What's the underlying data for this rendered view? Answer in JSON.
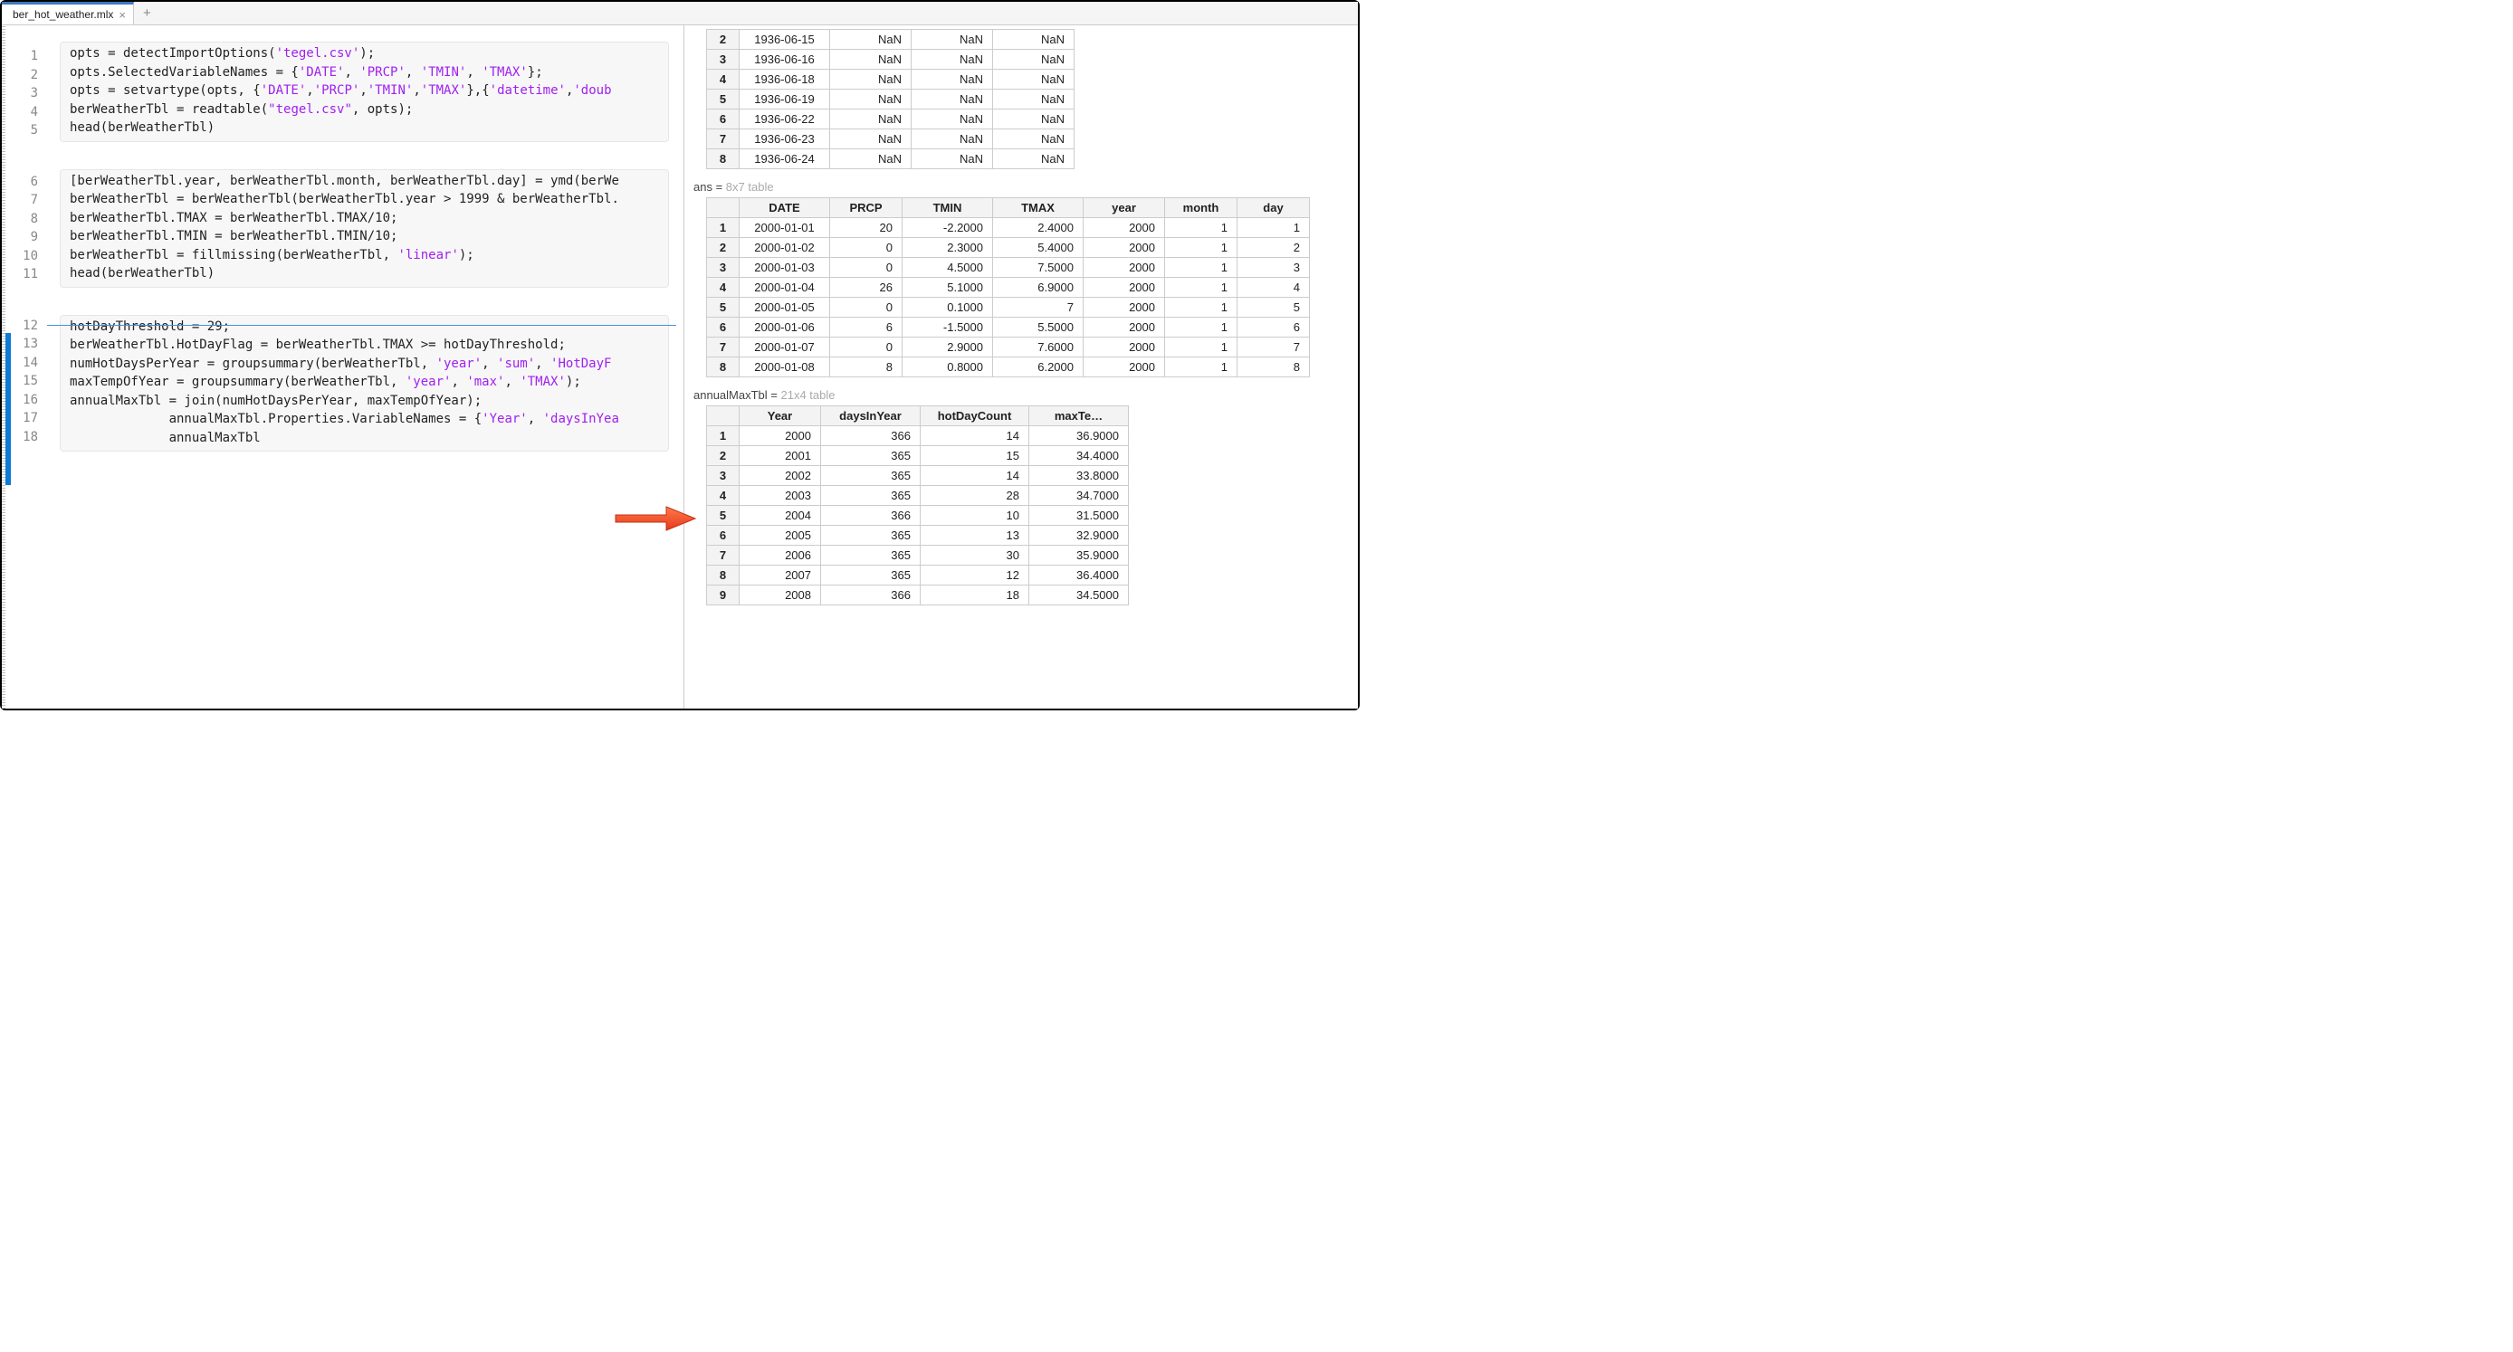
{
  "tab": {
    "title": "ber_hot_weather.mlx"
  },
  "lineNumbers": [
    1,
    2,
    3,
    4,
    5,
    6,
    7,
    8,
    9,
    10,
    11,
    12,
    13,
    14,
    15,
    16,
    17,
    18
  ],
  "code": {
    "cell1": [
      [
        [
          "plain",
          "opts = detectImportOptions("
        ],
        [
          "str",
          "'tegel.csv'"
        ],
        [
          "plain",
          ");"
        ]
      ],
      [
        [
          "plain",
          "opts.SelectedVariableNames = {"
        ],
        [
          "str",
          "'DATE'"
        ],
        [
          "plain",
          ", "
        ],
        [
          "str",
          "'PRCP'"
        ],
        [
          "plain",
          ", "
        ],
        [
          "str",
          "'TMIN'"
        ],
        [
          "plain",
          ", "
        ],
        [
          "str",
          "'TMAX'"
        ],
        [
          "plain",
          "};"
        ]
      ],
      [
        [
          "plain",
          "opts = setvartype(opts, {"
        ],
        [
          "str",
          "'DATE'"
        ],
        [
          "plain",
          ","
        ],
        [
          "str",
          "'PRCP'"
        ],
        [
          "plain",
          ","
        ],
        [
          "str",
          "'TMIN'"
        ],
        [
          "plain",
          ","
        ],
        [
          "str",
          "'TMAX'"
        ],
        [
          "plain",
          "},{"
        ],
        [
          "str",
          "'datetime'"
        ],
        [
          "plain",
          ","
        ],
        [
          "str",
          "'doub"
        ]
      ],
      [
        [
          "plain",
          "berWeatherTbl = readtable("
        ],
        [
          "str",
          "\"tegel.csv\""
        ],
        [
          "plain",
          ", opts);"
        ]
      ],
      [
        [
          "plain",
          "head(berWeatherTbl)"
        ]
      ]
    ],
    "cell2": [
      [
        [
          "plain",
          "[berWeatherTbl.year, berWeatherTbl.month, berWeatherTbl.day] = ymd(berWe"
        ]
      ],
      [
        [
          "plain",
          "berWeatherTbl = berWeatherTbl(berWeatherTbl.year > 1999 & berWeatherTbl."
        ]
      ],
      [
        [
          "plain",
          "berWeatherTbl.TMAX = berWeatherTbl.TMAX/10;"
        ]
      ],
      [
        [
          "plain",
          "berWeatherTbl.TMIN = berWeatherTbl.TMIN/10;"
        ]
      ],
      [
        [
          "plain",
          "berWeatherTbl = fillmissing(berWeatherTbl, "
        ],
        [
          "str",
          "'linear'"
        ],
        [
          "plain",
          ");"
        ]
      ],
      [
        [
          "plain",
          "head(berWeatherTbl)"
        ]
      ]
    ],
    "cell3": [
      [
        [
          "plain",
          "hotDayThreshold = 29;"
        ]
      ],
      [
        [
          "plain",
          "berWeatherTbl.HotDayFlag = berWeatherTbl.TMAX >= hotDayThreshold;"
        ]
      ],
      [
        [
          "plain",
          "numHotDaysPerYear = groupsummary(berWeatherTbl, "
        ],
        [
          "str",
          "'year'"
        ],
        [
          "plain",
          ", "
        ],
        [
          "str",
          "'sum'"
        ],
        [
          "plain",
          ", "
        ],
        [
          "str",
          "'HotDayF"
        ]
      ],
      [
        [
          "plain",
          "maxTempOfYear = groupsummary(berWeatherTbl, "
        ],
        [
          "str",
          "'year'"
        ],
        [
          "plain",
          ", "
        ],
        [
          "str",
          "'max'"
        ],
        [
          "plain",
          ", "
        ],
        [
          "str",
          "'TMAX'"
        ],
        [
          "plain",
          ");"
        ]
      ],
      [
        [
          "plain",
          "annualMaxTbl = join(numHotDaysPerYear, maxTempOfYear);"
        ]
      ],
      [
        [
          "plain",
          "             annualMaxTbl.Properties.VariableNames = {"
        ],
        [
          "str",
          "'Year'"
        ],
        [
          "plain",
          ", "
        ],
        [
          "str",
          "'daysInYea"
        ]
      ],
      [
        [
          "plain",
          "             annualMaxTbl"
        ]
      ]
    ]
  },
  "output": {
    "table1": {
      "rows": [
        [
          2,
          "1936-06-15",
          "NaN",
          "NaN",
          "NaN"
        ],
        [
          3,
          "1936-06-16",
          "NaN",
          "NaN",
          "NaN"
        ],
        [
          4,
          "1936-06-18",
          "NaN",
          "NaN",
          "NaN"
        ],
        [
          5,
          "1936-06-19",
          "NaN",
          "NaN",
          "NaN"
        ],
        [
          6,
          "1936-06-22",
          "NaN",
          "NaN",
          "NaN"
        ],
        [
          7,
          "1936-06-23",
          "NaN",
          "NaN",
          "NaN"
        ],
        [
          8,
          "1936-06-24",
          "NaN",
          "NaN",
          "NaN"
        ]
      ]
    },
    "table2": {
      "var": "ans",
      "dim": "8x7 table",
      "headers": [
        "",
        "DATE",
        "PRCP",
        "TMIN",
        "TMAX",
        "year",
        "month",
        "day"
      ],
      "rows": [
        [
          1,
          "2000-01-01",
          "20",
          "-2.2000",
          "2.4000",
          "2000",
          "1",
          "1"
        ],
        [
          2,
          "2000-01-02",
          "0",
          "2.3000",
          "5.4000",
          "2000",
          "1",
          "2"
        ],
        [
          3,
          "2000-01-03",
          "0",
          "4.5000",
          "7.5000",
          "2000",
          "1",
          "3"
        ],
        [
          4,
          "2000-01-04",
          "26",
          "5.1000",
          "6.9000",
          "2000",
          "1",
          "4"
        ],
        [
          5,
          "2000-01-05",
          "0",
          "0.1000",
          "7",
          "2000",
          "1",
          "5"
        ],
        [
          6,
          "2000-01-06",
          "6",
          "-1.5000",
          "5.5000",
          "2000",
          "1",
          "6"
        ],
        [
          7,
          "2000-01-07",
          "0",
          "2.9000",
          "7.6000",
          "2000",
          "1",
          "7"
        ],
        [
          8,
          "2000-01-08",
          "8",
          "0.8000",
          "6.2000",
          "2000",
          "1",
          "8"
        ]
      ]
    },
    "table3": {
      "var": "annualMaxTbl",
      "dim": "21x4 table",
      "headers": [
        "",
        "Year",
        "daysInYear",
        "hotDayCount",
        "maxTe…"
      ],
      "rows": [
        [
          1,
          "2000",
          "366",
          "14",
          "36.9000"
        ],
        [
          2,
          "2001",
          "365",
          "15",
          "34.4000"
        ],
        [
          3,
          "2002",
          "365",
          "14",
          "33.8000"
        ],
        [
          4,
          "2003",
          "365",
          "28",
          "34.7000"
        ],
        [
          5,
          "2004",
          "366",
          "10",
          "31.5000"
        ],
        [
          6,
          "2005",
          "365",
          "13",
          "32.9000"
        ],
        [
          7,
          "2006",
          "365",
          "30",
          "35.9000"
        ],
        [
          8,
          "2007",
          "365",
          "12",
          "36.4000"
        ],
        [
          9,
          "2008",
          "366",
          "18",
          "34.5000"
        ]
      ]
    }
  }
}
